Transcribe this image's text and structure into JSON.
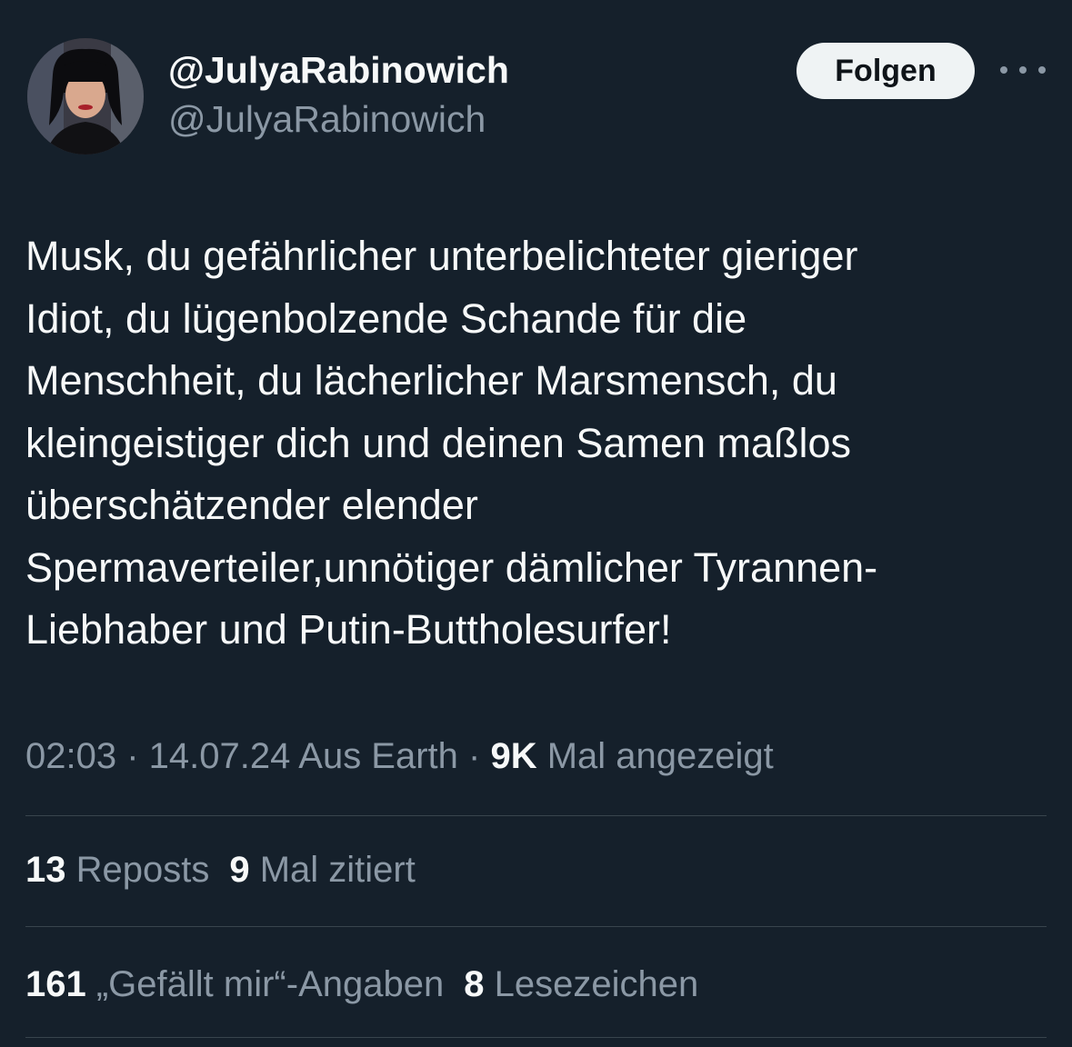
{
  "profile": {
    "display_name": "@JulyaRabinowich",
    "handle": "@JulyaRabinowich",
    "avatar_icon": "profile-photo"
  },
  "header": {
    "follow_label": "Folgen",
    "more_icon": "more-dots-icon"
  },
  "tweet": {
    "lines": [
      "Musk, du gefährlicher unterbelichteter gieriger",
      "Idiot, du lügenbolzende Schande für die",
      "Menschheit, du lächerlicher Marsmensch, du",
      "kleingeistiger dich und deinen Samen maßlos",
      "überschätzender elender",
      "Spermaverteiler,unnötiger dämlicher Tyrannen-",
      "Liebhaber und Putin-Buttholesurfer!"
    ]
  },
  "meta": {
    "time": "02:03",
    "sep1": " · ",
    "date": "14.07.24",
    "source": " Aus Earth",
    "sep2": " · ",
    "views_count": "9K",
    "views_label": " Mal angezeigt"
  },
  "stats": {
    "reposts_count": "13",
    "reposts_label": " Reposts",
    "quotes_count": "9",
    "quotes_label": " Mal zitiert",
    "likes_count": "161",
    "likes_label": " „Gefällt mir“-Angaben",
    "bookmarks_count": "8",
    "bookmarks_label": " Lesezeichen"
  },
  "colors": {
    "background": "#15202b",
    "primary_text": "#f7f9f9",
    "secondary_text": "#8b98a5",
    "divider": "#38444d",
    "button_bg": "#eff3f4"
  }
}
